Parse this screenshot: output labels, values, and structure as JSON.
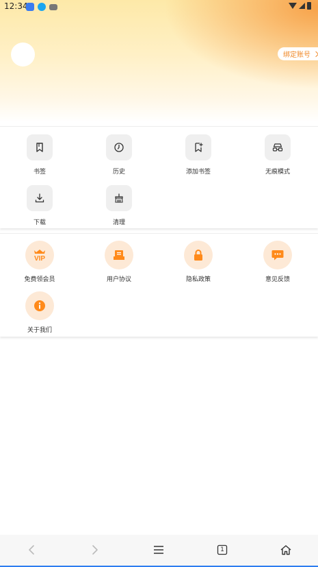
{
  "status_bar": {
    "time": "12:34",
    "app_icons": [
      "tv-app-icon",
      "qq-app-icon",
      "game-app-icon"
    ],
    "indicators": [
      "wifi-icon",
      "signal-icon",
      "battery-icon"
    ]
  },
  "header": {
    "bind_account_label": "绑定账号"
  },
  "tools": [
    {
      "label": "书签",
      "icon": "bookmark-icon"
    },
    {
      "label": "历史",
      "icon": "history-clock-icon"
    },
    {
      "label": "添加书签",
      "icon": "add-bookmark-icon"
    },
    {
      "label": "无痕模式",
      "icon": "incognito-glasses-icon"
    },
    {
      "label": "下载",
      "icon": "download-icon"
    },
    {
      "label": "清理",
      "icon": "clean-broom-icon"
    }
  ],
  "services": [
    {
      "label": "免费领会员",
      "icon": "vip-crown-icon"
    },
    {
      "label": "用户协议",
      "icon": "user-agreement-icon"
    },
    {
      "label": "隐私政策",
      "icon": "privacy-lock-icon"
    },
    {
      "label": "意见反馈",
      "icon": "feedback-chat-icon"
    },
    {
      "label": "关于我们",
      "icon": "info-icon"
    }
  ],
  "service_icon_text": {
    "vip": "VIP"
  },
  "bottom_nav": {
    "tab_count": "1",
    "buttons": [
      "back-arrow-icon",
      "forward-arrow-icon",
      "menu-icon",
      "tabs-icon",
      "home-icon"
    ]
  },
  "colors": {
    "accent_orange": "#f08a2a",
    "icon_orange": "#ff8a1a",
    "header_yellow": "#fde9a8",
    "bottom_bar_line": "#2d7df0"
  }
}
